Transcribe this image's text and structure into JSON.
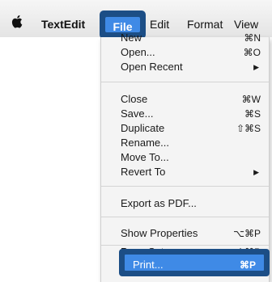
{
  "menubar": {
    "apple_icon": "apple-logo-icon",
    "app_name": "TextEdit",
    "items": [
      "File",
      "Edit",
      "Format",
      "View"
    ]
  },
  "file_menu": {
    "items": [
      {
        "label": "New",
        "shortcut": "⌘N"
      },
      {
        "label": "Open...",
        "shortcut": "⌘O"
      },
      {
        "label": "Open Recent",
        "submenu_arrow": "▶"
      },
      {
        "label": "Close",
        "shortcut": "⌘W"
      },
      {
        "label": "Save...",
        "shortcut": "⌘S"
      },
      {
        "label": "Duplicate",
        "shortcut": "⇧⌘S"
      },
      {
        "label": "Rename..."
      },
      {
        "label": "Move To..."
      },
      {
        "label": "Revert To",
        "submenu_arrow": "▶"
      },
      {
        "label": "Export as PDF..."
      },
      {
        "label": "Show Properties",
        "shortcut": "⌥⌘P"
      },
      {
        "label": "Page Setup...",
        "shortcut": "⇧⌘P"
      },
      {
        "label": "Print...",
        "shortcut": "⌘P"
      }
    ]
  },
  "colors": {
    "highlight": "#3f8ae6",
    "callout_border": "#1c4e86",
    "menu_bg": "#f4f4f4"
  }
}
